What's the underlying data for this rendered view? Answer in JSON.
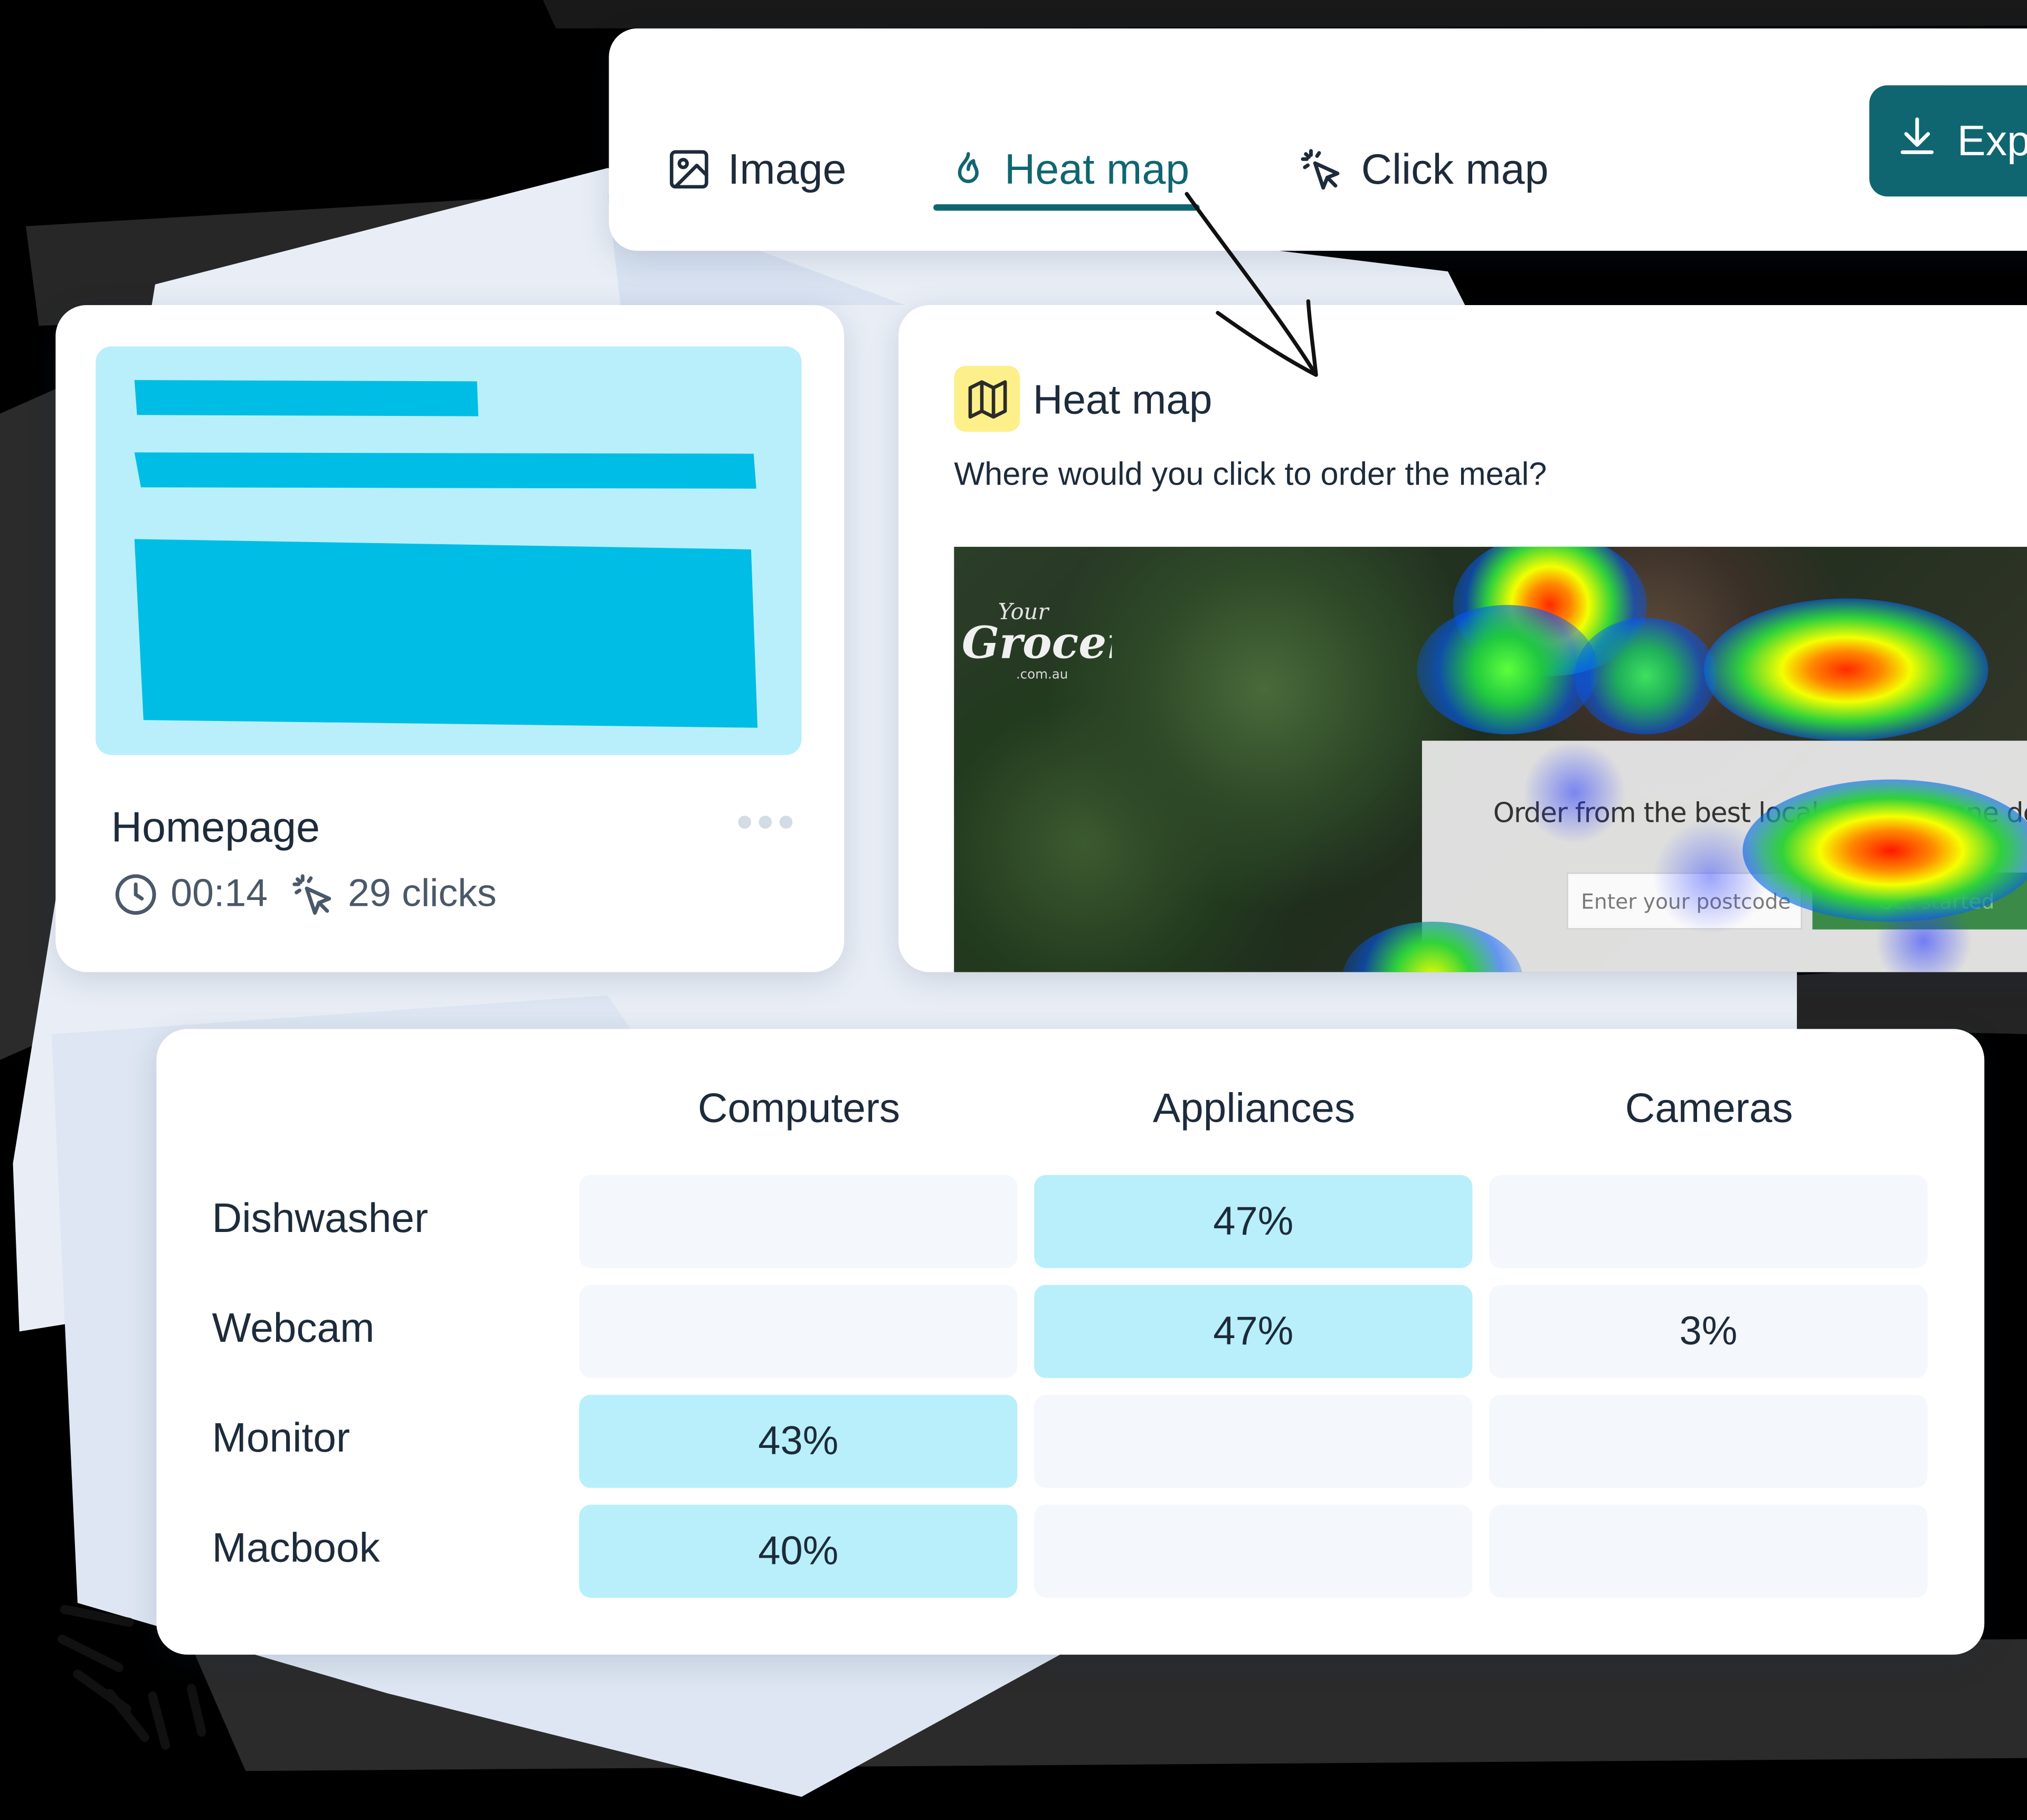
{
  "toolbar": {
    "tabs": [
      {
        "label": "Image",
        "icon": "image-icon"
      },
      {
        "label": "Heat map",
        "icon": "flame-icon",
        "active": true
      },
      {
        "label": "Click map",
        "icon": "cursor-click-icon"
      }
    ],
    "export_label": "Exp",
    "accent_color": "#0f6670"
  },
  "homepage_card": {
    "title": "Homepage",
    "duration": "00:14",
    "clicks": "29 clicks",
    "thumbnail_color": "#b8effa",
    "thumbnail_bar_color": "#00bde5"
  },
  "heatmap_card": {
    "title": "Heat map",
    "question": "Where would you click to order the meal?",
    "logo_text": [
      "Your",
      "Grocer",
      ".com.au"
    ],
    "site_text": "Order from the best local shops, in one del",
    "postcode_placeholder": "Enter your postcode",
    "cta_label": "Get started"
  },
  "matrix": {
    "columns": [
      "Computers",
      "Appliances",
      "Cameras"
    ],
    "rows": [
      {
        "label": "Dishwasher",
        "cells": [
          "",
          "47%",
          ""
        ]
      },
      {
        "label": "Webcam",
        "cells": [
          "",
          "47%",
          "3%"
        ]
      },
      {
        "label": "Monitor",
        "cells": [
          "43%",
          "",
          ""
        ]
      },
      {
        "label": "Macbook",
        "cells": [
          "40%",
          "",
          ""
        ]
      }
    ],
    "highlight_color": "#b8effa",
    "empty_color": "#f4f7fc"
  }
}
